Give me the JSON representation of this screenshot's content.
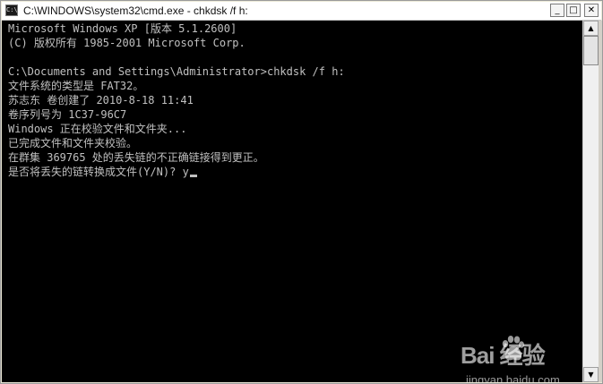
{
  "window": {
    "title": "C:\\WINDOWS\\system32\\cmd.exe - chkdsk  /f h:",
    "icon": "cmd-icon",
    "controls": {
      "minimize": "_",
      "maximize": "□",
      "close": "✕"
    }
  },
  "console": {
    "lines": [
      "Microsoft Windows XP [版本 5.1.2600]",
      "(C) 版权所有 1985-2001 Microsoft Corp.",
      "",
      "C:\\Documents and Settings\\Administrator>chkdsk /f h:",
      "文件系统的类型是 FAT32。",
      "苏志东 卷创建了 2010-8-18 11:41",
      "卷序列号为 1C37-96C7",
      "Windows 正在校验文件和文件夹...",
      "已完成文件和文件夹校验。",
      "在群集 369765 处的丢失链的不正确链接得到更正。",
      "是否将丢失的链转换成文件(Y/N)? y"
    ]
  },
  "scrollbar": {
    "up_arrow": "▲",
    "down_arrow": "▼"
  },
  "watermark": {
    "brand": "Bai  经验",
    "site": "jingyan.baidu.com"
  },
  "colors": {
    "console_bg": "#000000",
    "console_text": "#c0c0c0"
  }
}
